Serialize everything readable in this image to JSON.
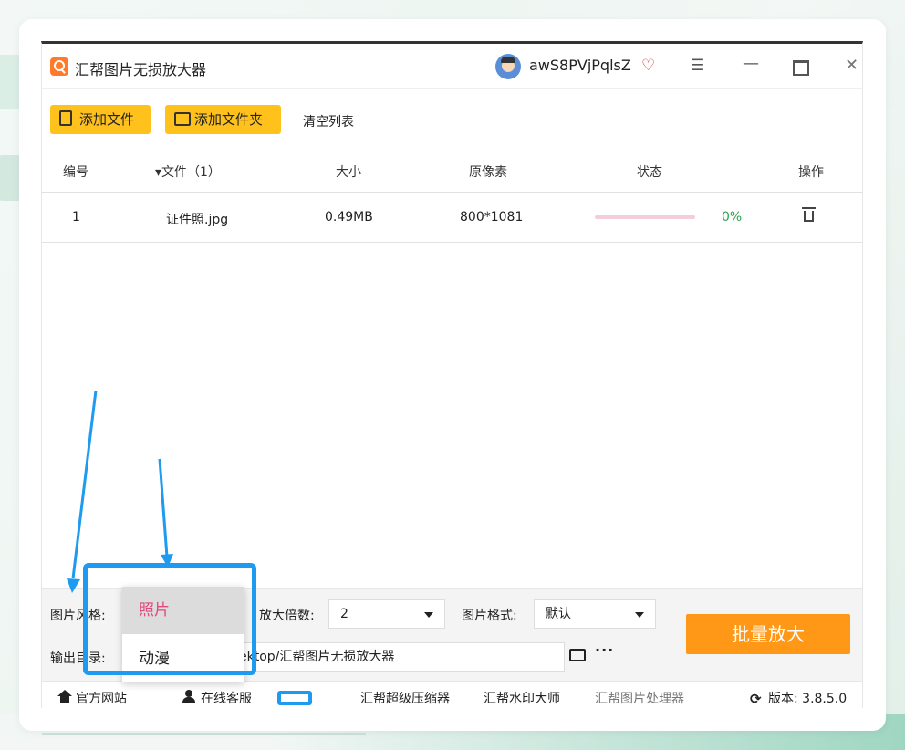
{
  "app": {
    "title": "汇帮图片无损放大器",
    "username": "awS8PVjPqlsZ"
  },
  "window_controls": {
    "menu_icon": "hamburger-icon",
    "minimize_icon": "minimize-icon",
    "maximize_icon": "maximize-icon",
    "close_icon": "close-icon"
  },
  "toolbar": {
    "add_file": "添加文件",
    "add_folder": "添加文件夹",
    "clear_list": "清空列表"
  },
  "table": {
    "headers": [
      "编号",
      "▾文件（1）",
      "大小",
      "原像素",
      "状态",
      "操作"
    ],
    "rows": [
      {
        "index": "1",
        "name": "证件照.jpg",
        "size": "0.49MB",
        "pixels": "800*1081",
        "progress_pct": 0,
        "progress_text": "0%"
      }
    ]
  },
  "settings": {
    "style_label": "图片风格:",
    "style_options": [
      "照片",
      "动漫"
    ],
    "style_selected": "照片",
    "scale_label": "放大倍数:",
    "scale_value": "2",
    "format_label": "图片格式:",
    "format_value": "默认",
    "output_label": "输出目录:",
    "output_path": "ektop/汇帮图片无损放大器",
    "more": "···",
    "batch_button": "批量放大"
  },
  "footer": {
    "website": "官方网站",
    "support": "在线客服",
    "compressor": "汇帮超级压缩器",
    "watermark": "汇帮水印大师",
    "processor": "汇帮图片处理器",
    "version": "版本: 3.8.5.0"
  },
  "colors": {
    "accent_yellow": "#ffc21c",
    "batch_orange": "#ff9817",
    "progress_green": "#2aa44a",
    "annotation_blue": "#1e9bf0",
    "selected_option": "#e04a7b"
  }
}
